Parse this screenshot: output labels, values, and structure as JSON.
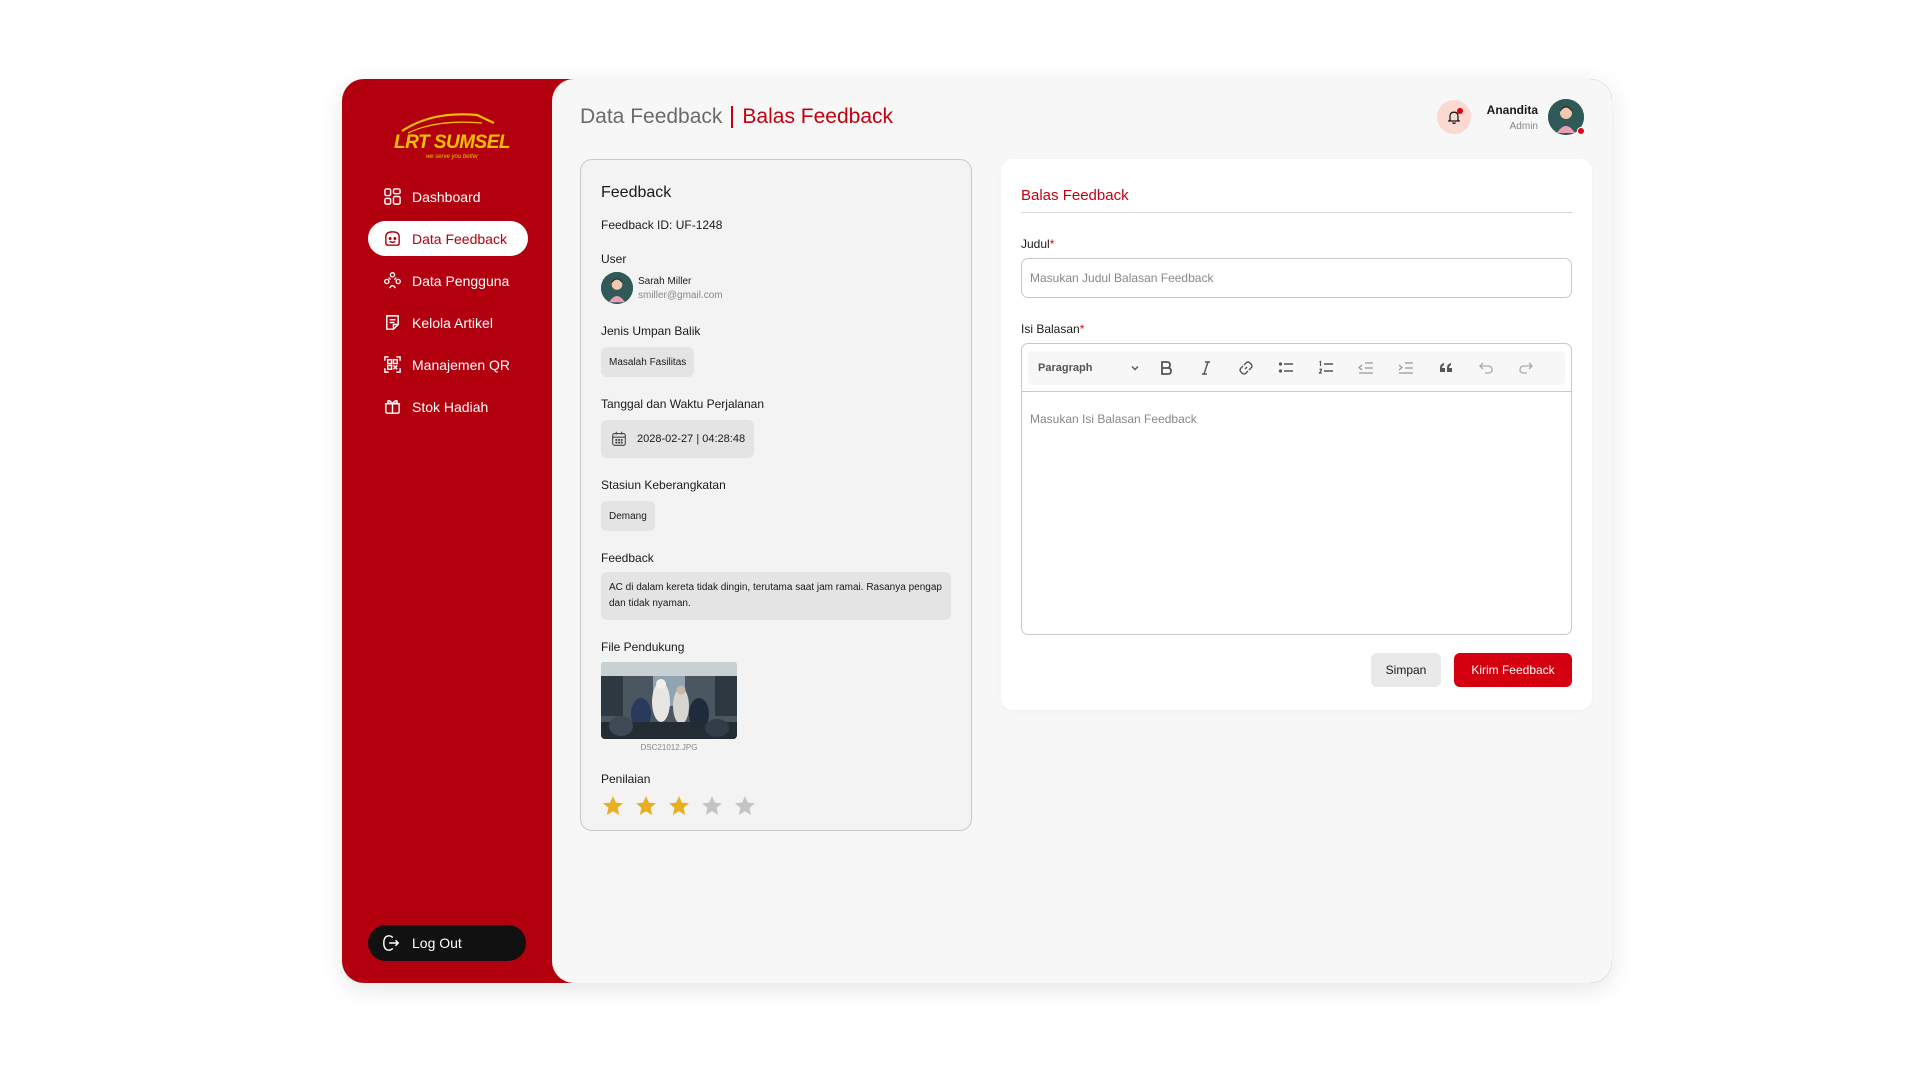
{
  "brand": {
    "logo_text": "LRT SUMSEL",
    "tagline": "we serve you better",
    "primary_color": "#b3000f",
    "accent_color": "#f2c200"
  },
  "sidebar": {
    "items": [
      {
        "label": "Dashboard",
        "icon": "dashboard-icon"
      },
      {
        "label": "Data Feedback",
        "icon": "feedback-icon",
        "active": true
      },
      {
        "label": "Data Pengguna",
        "icon": "users-icon"
      },
      {
        "label": "Kelola Artikel",
        "icon": "article-icon"
      },
      {
        "label": "Manajemen QR",
        "icon": "qr-icon"
      },
      {
        "label": "Stok Hadiah",
        "icon": "gift-icon"
      }
    ],
    "logout_label": "Log Out"
  },
  "header": {
    "breadcrumb_parent": "Data Feedback",
    "breadcrumb_current": "Balas Feedback",
    "user_name": "Anandita",
    "user_role": "Admin"
  },
  "feedback": {
    "title": "Feedback",
    "id_text": "Feedback ID: UF-1248",
    "user_label": "User",
    "user_name": "Sarah Miller",
    "user_email": "smiller@gmail.com",
    "type_label": "Jenis Umpan Balik",
    "type_value": "Masalah Fasilitas",
    "datetime_label": "Tanggal dan Waktu Perjalanan",
    "datetime_value": "2028-02-27 | 04:28:48",
    "station_label": "Stasiun Keberangkatan",
    "station_value": "Demang",
    "feedback_label": "Feedback",
    "feedback_text": "AC di dalam kereta tidak dingin, terutama saat jam ramai. Rasanya pengap dan tidak nyaman.",
    "file_label": "File Pendukung",
    "file_name": "DSC21012.JPG",
    "rating_label": "Penilaian",
    "rating": 3,
    "rating_max": 5,
    "star_color": "#e8b021",
    "star_empty_color": "#c4c4c4"
  },
  "reply": {
    "title": "Balas Feedback",
    "judul_label": "Judul",
    "judul_placeholder": "Masukan Judul Balasan Feedback",
    "isi_label": "Isi Balasan",
    "required_mark": "*",
    "paragraph_label": "Paragraph",
    "isi_placeholder": "Masukan Isi Balasan Feedback",
    "save_label": "Simpan",
    "send_label": "Kirim Feedback"
  }
}
